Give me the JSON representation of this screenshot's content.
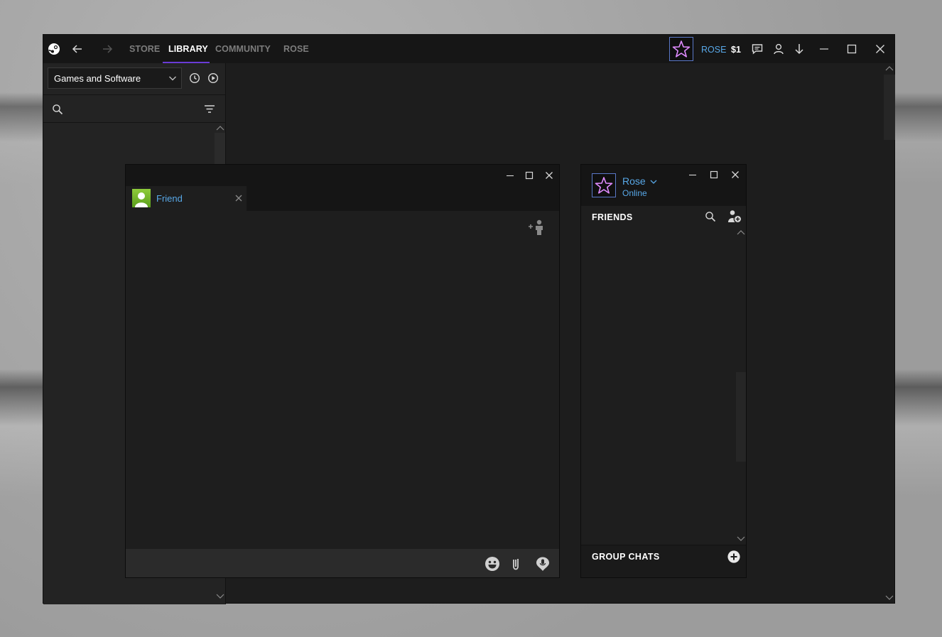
{
  "nav": {
    "tabs": [
      {
        "label": "STORE"
      },
      {
        "label": "LIBRARY",
        "active": true
      },
      {
        "label": "COMMUNITY"
      },
      {
        "label": "ROSE"
      }
    ]
  },
  "account": {
    "username": "ROSE",
    "wallet": "$1"
  },
  "library": {
    "filter_selected": "Games and Software"
  },
  "chat": {
    "tab_name": "Friend"
  },
  "friends": {
    "user_name": "Rose",
    "user_status": "Online",
    "friends_title": "FRIENDS",
    "group_chats_title": "GROUP CHATS"
  },
  "colors": {
    "accent_blue": "#58a8e8",
    "accent_purple": "#6a3bd6",
    "star_pink": "#e08cff"
  }
}
